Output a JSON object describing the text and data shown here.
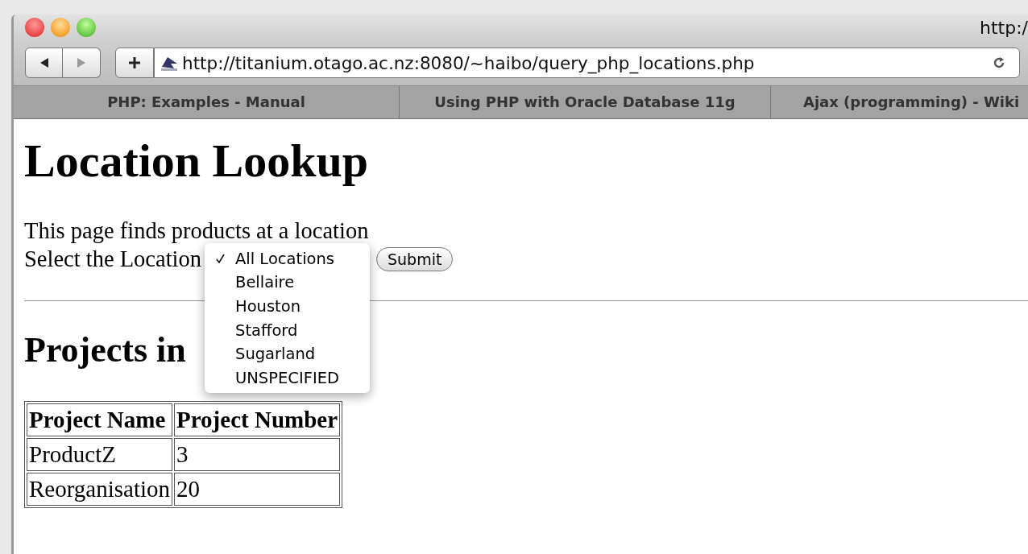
{
  "window": {
    "title": "http:/"
  },
  "toolbar": {
    "url": "http://titanium.otago.ac.nz:8080/~haibo/query_php_locations.php"
  },
  "tabs": [
    {
      "label": "PHP: Examples - Manual",
      "selected": false
    },
    {
      "label": "Using PHP with Oracle Database 11g",
      "selected": false
    },
    {
      "label": "Ajax (programming) - Wiki",
      "selected": false
    }
  ],
  "page": {
    "heading": "Location Lookup",
    "intro": "This page finds products at a location",
    "select_label": "Select the Location",
    "submit": "Submit",
    "results_heading": "Projects in",
    "location_menu": [
      {
        "label": "All Locations",
        "selected": true
      },
      {
        "label": "Bellaire",
        "selected": false
      },
      {
        "label": "Houston",
        "selected": false
      },
      {
        "label": "Stafford",
        "selected": false
      },
      {
        "label": "Sugarland",
        "selected": false
      },
      {
        "label": "UNSPECIFIED",
        "selected": false
      }
    ],
    "table": {
      "columns": [
        "Project Name",
        "Project Number"
      ],
      "rows": [
        [
          "ProductZ",
          "3"
        ],
        [
          "Reorganisation",
          "20"
        ]
      ]
    }
  }
}
